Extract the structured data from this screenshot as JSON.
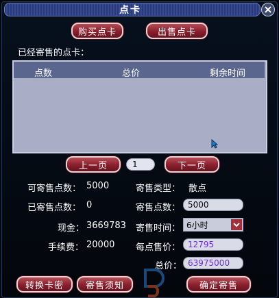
{
  "window": {
    "title": "点卡"
  },
  "tabs": {
    "buy": "购买点卡",
    "sell": "出售点卡"
  },
  "list": {
    "caption": "已经寄售的点卡：",
    "columns": [
      "点数",
      "总价",
      "剩余时间"
    ],
    "rows": []
  },
  "pagination": {
    "prev": "上一页",
    "page": "1",
    "next": "下一页"
  },
  "stats": {
    "sellable_label": "可寄售点数：",
    "sellable_value": "5000",
    "sold_label": "已寄售点数：",
    "sold_value": "0",
    "cash_label": "现金：",
    "cash_value": "3669783",
    "fee_label": "手续费：",
    "fee_value": "20000"
  },
  "form": {
    "type_label": "寄售类型：",
    "type_value": "散点",
    "points_label": "寄售点数：",
    "points_value": "5000",
    "time_label": "寄售时间：",
    "time_value": "6小时",
    "unit_price_label": "每点售价：",
    "unit_price_value": "12795",
    "total_label": "总价：",
    "total_value": "63975000"
  },
  "buttons": {
    "convert": "转换卡密",
    "notice": "寄售须知",
    "confirm": "确定寄售"
  },
  "colors": {
    "button": "#8a1f2c",
    "panel": "#a9aec6",
    "header": "#5b668f",
    "purple_text": "#6c2bd9"
  },
  "icons": {
    "close": "close-icon",
    "dropdown": "chevron-down-icon",
    "cursor": "pointer-cursor-icon"
  }
}
